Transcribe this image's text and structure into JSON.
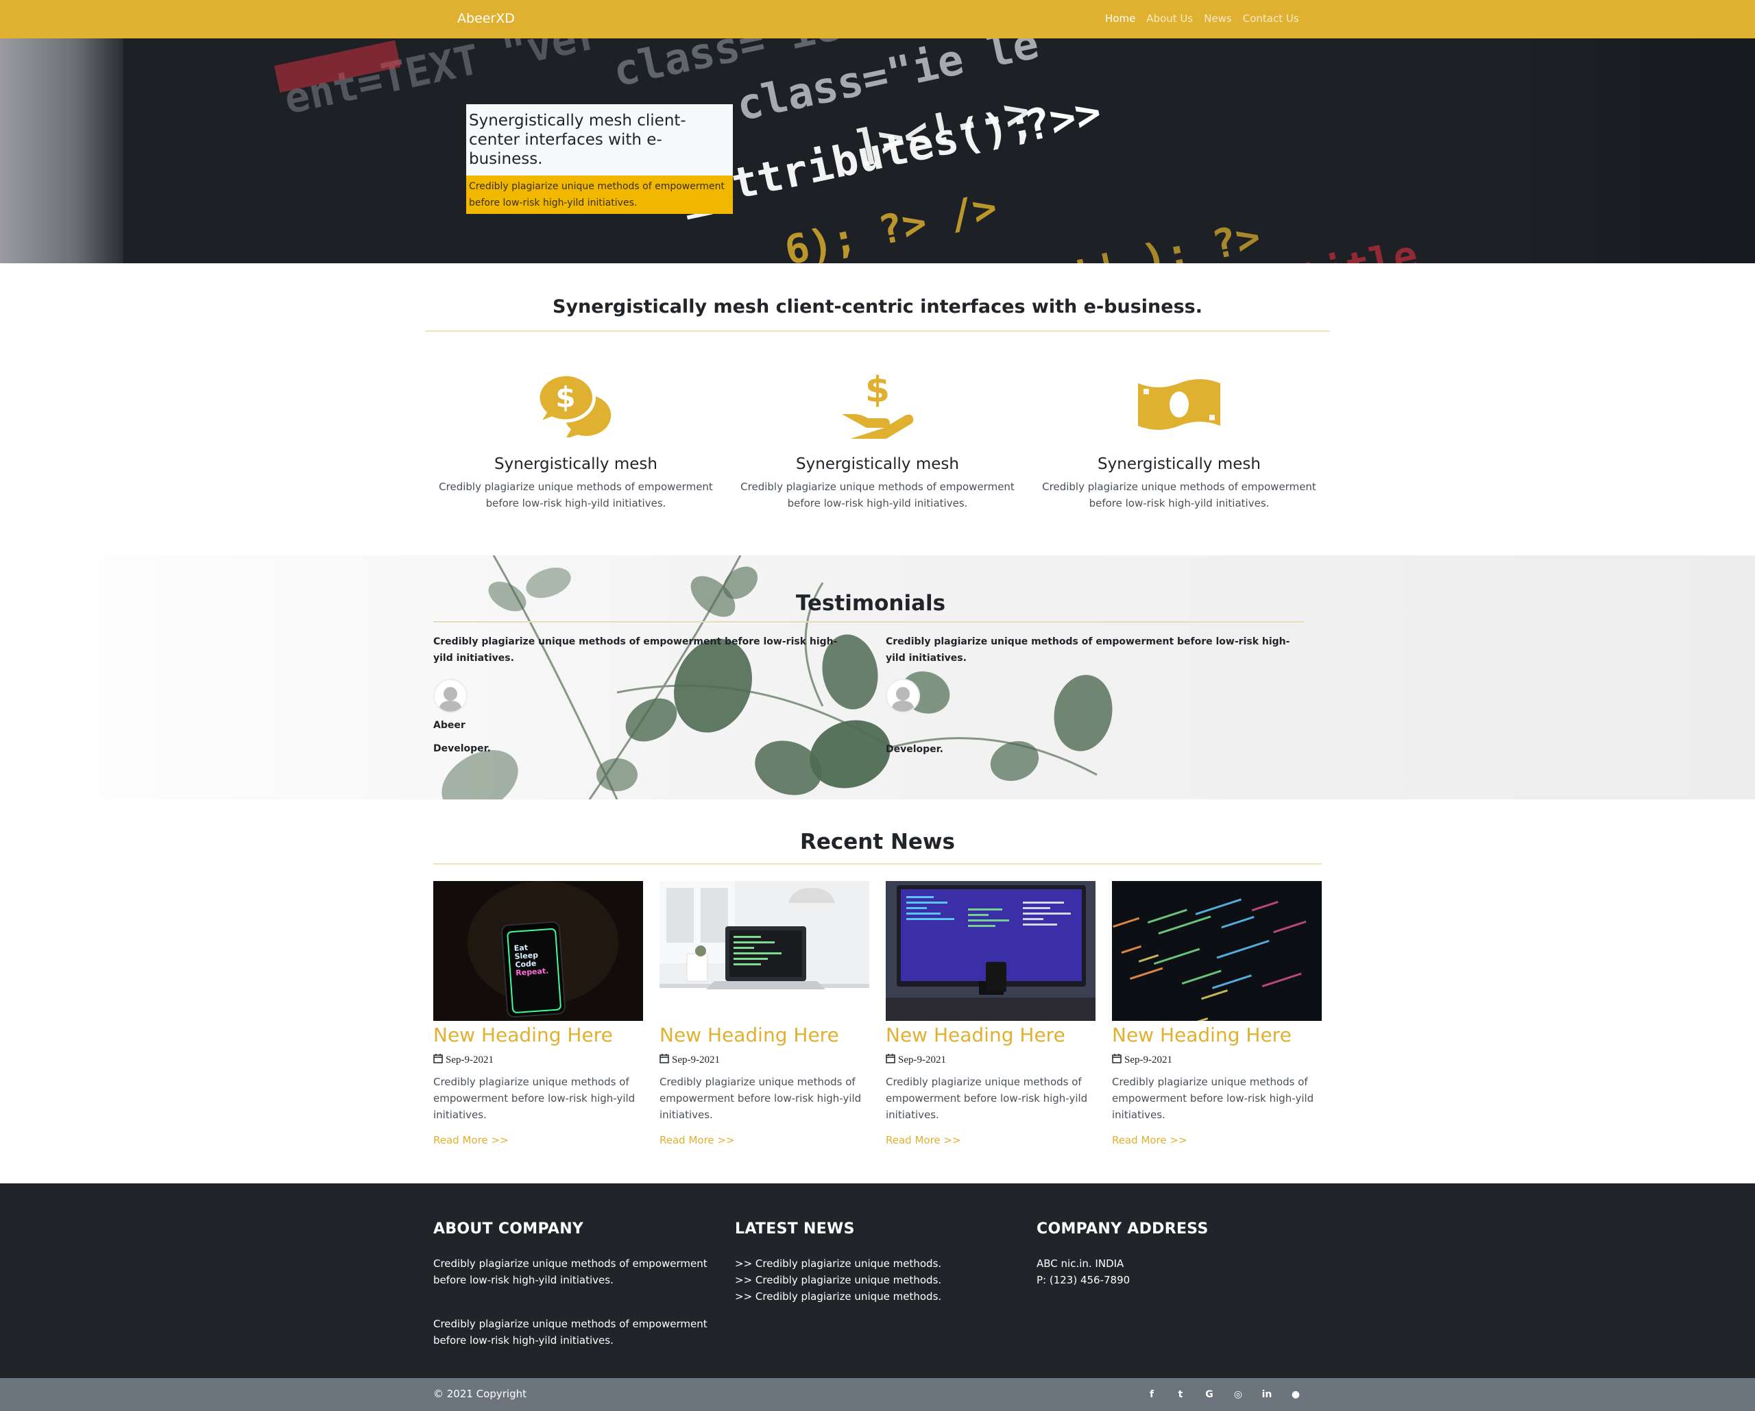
{
  "navbar": {
    "brand": "AbeerXD",
    "links": [
      {
        "label": "Home"
      },
      {
        "label": "About Us"
      },
      {
        "label": "News"
      },
      {
        "label": "Contact Us"
      }
    ],
    "color": "#e0b030"
  },
  "hero": {
    "title": "Synergistically mesh client-center interfaces with e-business.",
    "text": "Credibly plagiarize unique methods of empowerment before low-risk high-yild initiatives."
  },
  "features": {
    "heading": "Synergistically mesh client-centric interfaces with e-business.",
    "items": [
      {
        "icon": "comments-dollar-icon",
        "title": "Synergistically mesh",
        "text": "Credibly plagiarize unique methods of empowerment before low-risk high-yild initiatives."
      },
      {
        "icon": "hand-holding-usd-icon",
        "title": "Synergistically mesh",
        "text": "Credibly plagiarize unique methods of empowerment before low-risk high-yild initiatives."
      },
      {
        "icon": "money-bill-icon",
        "title": "Synergistically mesh",
        "text": "Credibly plagiarize unique methods of empowerment before low-risk high-yild initiatives."
      }
    ]
  },
  "testimonials": {
    "heading": "Testimonials",
    "items": [
      {
        "quote": "Credibly plagiarize unique methods of empowerment before low-risk high-yild initiatives.",
        "name": "Abeer",
        "role": "Developer."
      },
      {
        "quote": "Credibly plagiarize unique methods of empowerment before low-risk high-yild initiatives.",
        "name": "",
        "role": "Developer."
      }
    ]
  },
  "news": {
    "heading": "Recent News",
    "items": [
      {
        "title": "New Heading Here",
        "date": "Sep-9-2021",
        "text": "Credibly plagiarize unique methods of empowerment before low-risk high-yild initiatives.",
        "more": "Read More >>",
        "phone_text": [
          "Eat",
          "Sleep",
          "Code",
          "Repeat."
        ]
      },
      {
        "title": "New Heading Here",
        "date": "Sep-9-2021",
        "text": "Credibly plagiarize unique methods of empowerment before low-risk high-yild initiatives.",
        "more": "Read More >>"
      },
      {
        "title": "New Heading Here",
        "date": "Sep-9-2021",
        "text": "Credibly plagiarize unique methods of empowerment before low-risk high-yild initiatives.",
        "more": "Read More >>"
      },
      {
        "title": "New Heading Here",
        "date": "Sep-9-2021",
        "text": "Credibly plagiarize unique methods of empowerment before low-risk high-yild initiatives.",
        "more": "Read More >>"
      }
    ]
  },
  "footer": {
    "about": {
      "title": "ABOUT COMPANY",
      "paragraphs": [
        "Credibly plagiarize unique methods of empowerment before low-risk high-yild initiatives.",
        "Credibly plagiarize unique methods of empowerment before low-risk high-yild initiatives."
      ]
    },
    "latest": {
      "title": "LATEST NEWS",
      "items": [
        ">> Credibly plagiarize unique methods.",
        ">> Credibly plagiarize unique methods.",
        ">> Credibly plagiarize unique methods."
      ]
    },
    "address": {
      "title": "COMPANY ADDRESS",
      "lines": [
        "ABC nic.in. INDIA",
        "P: (123) 456-7890"
      ]
    }
  },
  "bottom": {
    "copyright": "© 2021 Copyright",
    "socials": [
      {
        "icon": "facebook-icon",
        "glyph": "f"
      },
      {
        "icon": "twitter-icon",
        "glyph": "t"
      },
      {
        "icon": "google-icon",
        "glyph": "G"
      },
      {
        "icon": "instagram-icon",
        "glyph": "◎"
      },
      {
        "icon": "linkedin-icon",
        "glyph": "in"
      },
      {
        "icon": "github-icon",
        "glyph": "●"
      }
    ]
  }
}
